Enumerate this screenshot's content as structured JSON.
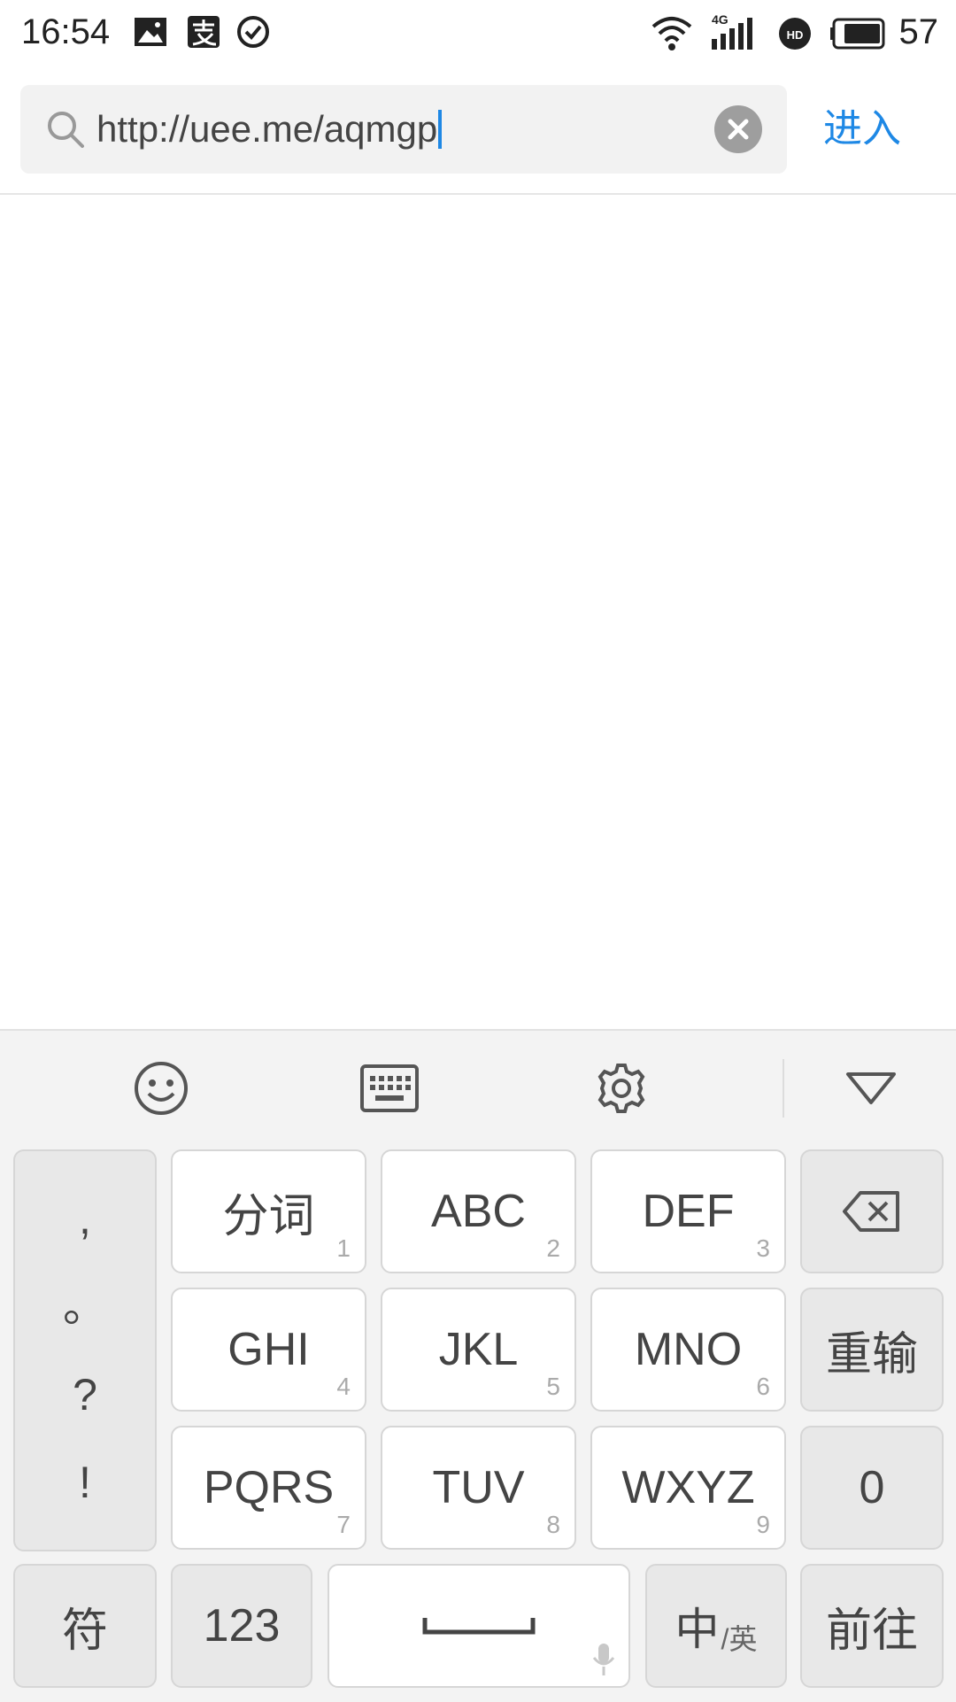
{
  "status_bar": {
    "time": "16:54",
    "network": "4G",
    "battery": "57"
  },
  "search": {
    "url_value": "http://uee.me/aqmgp",
    "enter_label": "进入"
  },
  "keyboard": {
    "punctuation": [
      ",",
      "。",
      "?",
      "!"
    ],
    "keys": [
      {
        "label": "分词",
        "sub": "1"
      },
      {
        "label": "ABC",
        "sub": "2"
      },
      {
        "label": "DEF",
        "sub": "3"
      },
      {
        "label": "GHI",
        "sub": "4"
      },
      {
        "label": "JKL",
        "sub": "5"
      },
      {
        "label": "MNO",
        "sub": "6"
      },
      {
        "label": "PQRS",
        "sub": "7"
      },
      {
        "label": "TUV",
        "sub": "8"
      },
      {
        "label": "WXYZ",
        "sub": "9"
      }
    ],
    "reset_label": "重输",
    "zero_label": "0",
    "symbol_label": "符",
    "num_label": "123",
    "lang_main": "中",
    "lang_sub": "/英",
    "go_label": "前往"
  },
  "colors": {
    "accent": "#1e88e5",
    "keyboard_bg": "#f3f3f3"
  }
}
